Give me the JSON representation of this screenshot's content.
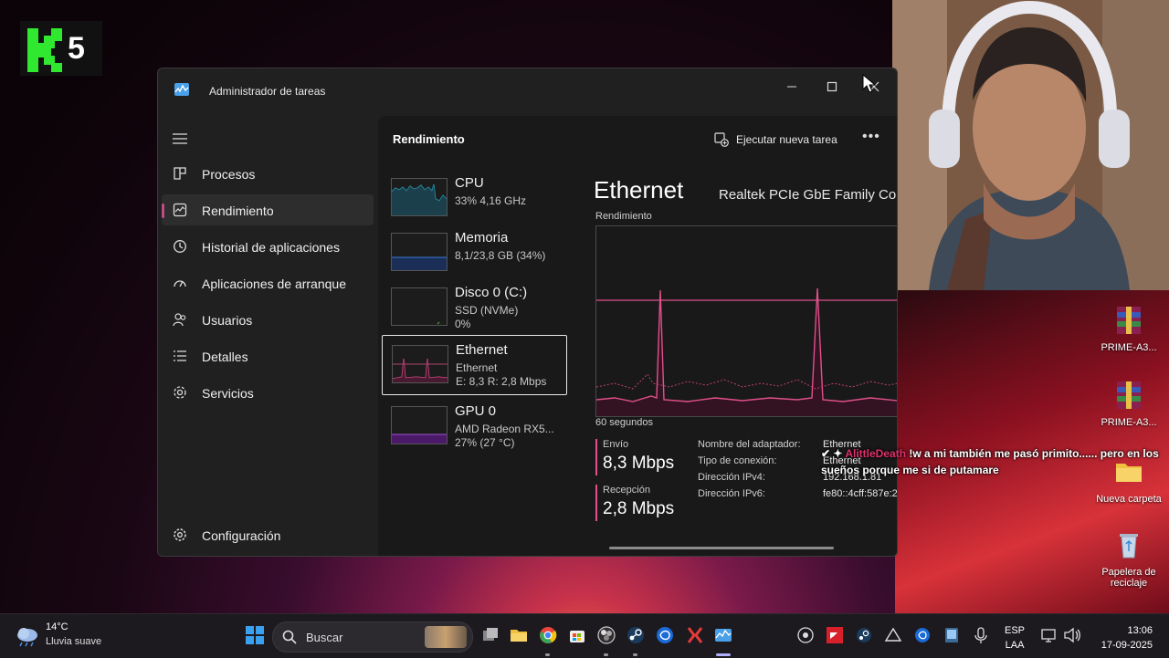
{
  "stream": {
    "logo_number": "5"
  },
  "window": {
    "title": "Administrador de tareas",
    "nav": [
      {
        "label": "Procesos"
      },
      {
        "label": "Rendimiento"
      },
      {
        "label": "Historial de aplicaciones"
      },
      {
        "label": "Aplicaciones de arranque"
      },
      {
        "label": "Usuarios"
      },
      {
        "label": "Detalles"
      },
      {
        "label": "Servicios"
      }
    ],
    "settings_label": "Configuración",
    "header": {
      "title": "Rendimiento",
      "run_task": "Ejecutar nueva tarea",
      "more": "•••"
    },
    "resources": [
      {
        "name": "CPU",
        "line1": "33% 4,16 GHz",
        "line2": ""
      },
      {
        "name": "Memoria",
        "line1": "8,1/23,8 GB (34%)",
        "line2": ""
      },
      {
        "name": "Disco 0 (C:)",
        "line1": "SSD (NVMe)",
        "line2": "0%"
      },
      {
        "name": "Ethernet",
        "line1": "Ethernet",
        "line2": "E: 8,3 R: 2,8 Mbps"
      },
      {
        "name": "GPU 0",
        "line1": "AMD Radeon RX5...",
        "line2": "27% (27 °C)"
      }
    ],
    "detail": {
      "title": "Ethernet",
      "model": "Realtek PCIe GbE Family Co",
      "graph_label": "Rendimiento",
      "graph_footer": "60 segundos",
      "send_label": "Envío",
      "send_value": "8,3 Mbps",
      "receive_label": "Recepción",
      "receive_value": "2,8 Mbps",
      "props": [
        {
          "key": "Nombre del adaptador:",
          "value": "Ethernet"
        },
        {
          "key": "Tipo de conexión:",
          "value": "Ethernet"
        },
        {
          "key": "Dirección IPv4:",
          "value": "192.168.1.81"
        },
        {
          "key": "Dirección IPv6:",
          "value": "fe80::4cff:587e:2"
        }
      ]
    }
  },
  "chat": {
    "user": "AlittleDeath",
    "message": "!w a mi también me pasó primito...... pero en los sueños porque me si de putamare"
  },
  "desktop_icons": [
    {
      "label": "PRIME-A3..."
    },
    {
      "label": "PRIME-A3..."
    },
    {
      "label": "Nueva carpeta"
    },
    {
      "label": "Papelera de reciclaje"
    }
  ],
  "taskbar": {
    "weather_temp": "14°C",
    "weather_cond": "Lluvia suave",
    "search_placeholder": "Buscar",
    "lang_1": "ESP",
    "lang_2": "LAA",
    "time": "13:06",
    "date": "17-09-2025"
  },
  "colors": {
    "accent": "#e0508a",
    "gpu": "#a050d0",
    "cpu": "#2aa8c8",
    "memory": "#3a7ad8",
    "disk": "#6ab04a"
  }
}
